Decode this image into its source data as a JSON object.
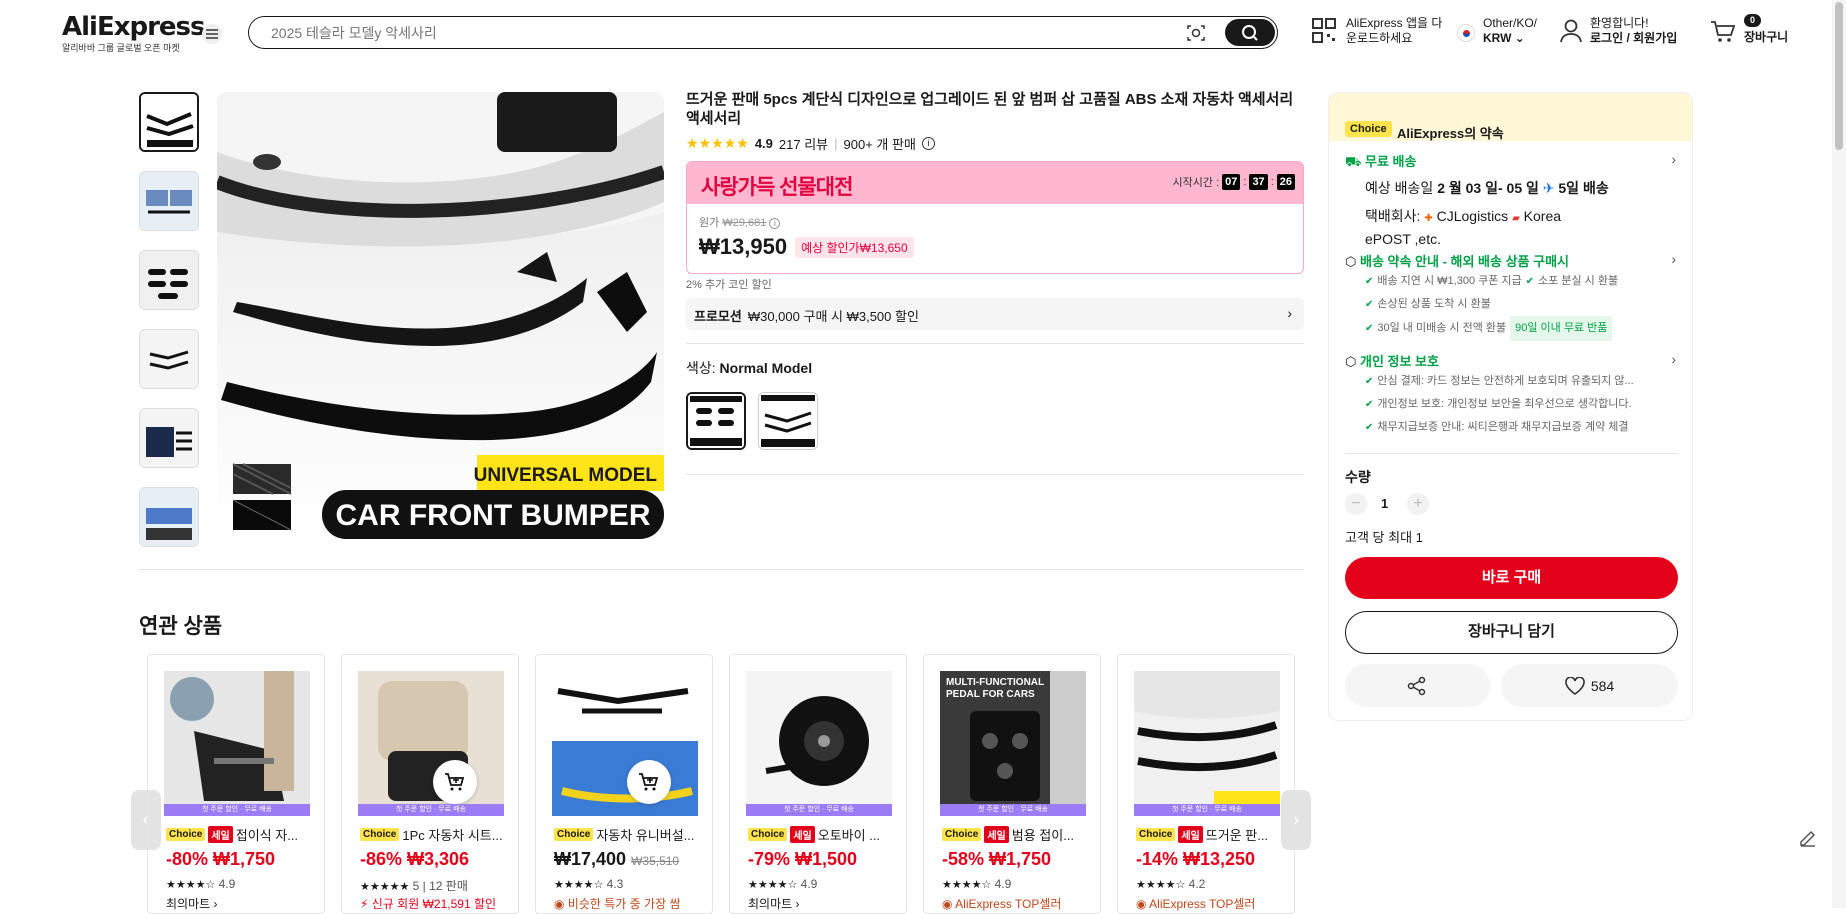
{
  "header": {
    "logo_text": "AliExpress",
    "logo_sub": "알리바바 그룹 글로벌 오픈 마켓",
    "search_placeholder": "2025 테슬라 모델y 악세사리",
    "app_line1": "AliExpress 앱을 다",
    "app_line2": "운로드하세요",
    "region_line1": "Other/KO/",
    "region_line2": "KRW",
    "account_line1": "환영합니다!",
    "account_line2": "로그인 / 회원가입",
    "cart_count": "0",
    "cart_label": "장바구니"
  },
  "product": {
    "title": "뜨거운 판매 5pcs 계단식 디자인으로 업그레이드 된 앞 범퍼 삽 고품질 ABS 소재 자동차 액세서리 액세서리",
    "rating": "4.9",
    "reviews": "217 리뷰",
    "sold": "900+ 개 판매",
    "image_text_top": "UNIVERSAL MODEL",
    "image_text_bottom": "CAR FRONT BUMPER",
    "promo_title": "사랑가득 선물대전",
    "promo_start_label": "시작시간 :",
    "timer": [
      "07",
      "37",
      "26"
    ],
    "orig_label": "원가",
    "orig_price": "₩29,681",
    "price": "₩13,950",
    "discount_tag": "예상 할인가₩13,650",
    "coin_text": "2% 추가 코인 할인",
    "promotion_label": "프로모션",
    "promotion_text": "₩30,000 구매 시 ₩3,500 할인",
    "color_label": "색상:",
    "color_value": "Normal Model"
  },
  "side": {
    "choice": "Choice",
    "promise": "AliExpress의 약속",
    "free_shipping": "무료 배송",
    "delivery_prefix": "예상 배송일",
    "delivery_dates": "2 월 03 일- 05 일",
    "delivery_days": "5일 배송",
    "courier_label": "택배회사:",
    "courier1": "CJLogistics",
    "courier2": "Korea",
    "courier3": "ePOST ,etc.",
    "guarantee_title": "배송 약속 안내 - 해외 배송 상품 구매시",
    "g1": "배송 지연 시 ₩1,300 쿠폰 지급",
    "g2": "소포 분실 시 환불",
    "g3": "손상된 상품 도착 시 환불",
    "g4": "30일 내 미배송 시 전액 환불",
    "g4_tag": "90일 이내 무료 반품",
    "privacy_title": "개인 정보 보호",
    "p1": "안심 결제: 카드 정보는 안전하게 보호되며 유출되지 않...",
    "p2": "개인정보 보호: 개인정보 보안을 최우선으로 생각합니다.",
    "p3": "채무지급보증 안내: 씨티은행과 채무지급보증 계약 체결",
    "qty_label": "수량",
    "qty_value": "1",
    "qty_limit": "고객 당 최대 1",
    "buy_now": "바로 구매",
    "add_cart": "장바구니 담기",
    "likes": "584"
  },
  "related": {
    "title": "연관 상품",
    "banner": "첫 주문 할인 · 무료 배송",
    "items": [
      {
        "choice": "Choice",
        "sale": "세일",
        "name": "접이식 자...",
        "price": "-80% ₩1,750",
        "stars": "★★★★☆",
        "rate": "4.9",
        "extra": "최의마트 ›"
      },
      {
        "choice": "Choice",
        "sale": "",
        "name": "1Pc 자동차 시트...",
        "price": "-86% ₩3,306",
        "stars": "★★★★★",
        "rate": "5 | 12 판매",
        "extra": "⚡ 신규 회원 ₩21,591 할인"
      },
      {
        "choice": "Choice",
        "sale": "",
        "name": "자동차 유니버설...",
        "price": "₩17,400",
        "orig": "₩35,510",
        "stars": "★★★★☆",
        "rate": "4.3",
        "extra": "◉ 비슷한 특가 중 가장 쌈"
      },
      {
        "choice": "Choice",
        "sale": "세일",
        "name": "오토바이 ...",
        "price": "-79% ₩1,500",
        "stars": "★★★★☆",
        "rate": "4.9",
        "extra": "최의마트 ›"
      },
      {
        "choice": "Choice",
        "sale": "세일",
        "name": "범용 접이...",
        "price": "-58% ₩1,750",
        "stars": "★★★★☆",
        "rate": "4.9",
        "extra": "◉ AliExpress TOP셀러"
      },
      {
        "choice": "Choice",
        "sale": "세일",
        "name": "뜨거운 판...",
        "price": "-14% ₩13,250",
        "stars": "★★★★☆",
        "rate": "4.2",
        "extra": "◉ AliExpress TOP셀러"
      }
    ]
  },
  "colors": {
    "accent": "#e3001b",
    "green": "#00a046",
    "choice": "#ffe34d",
    "promo": "#ffb7cf"
  }
}
